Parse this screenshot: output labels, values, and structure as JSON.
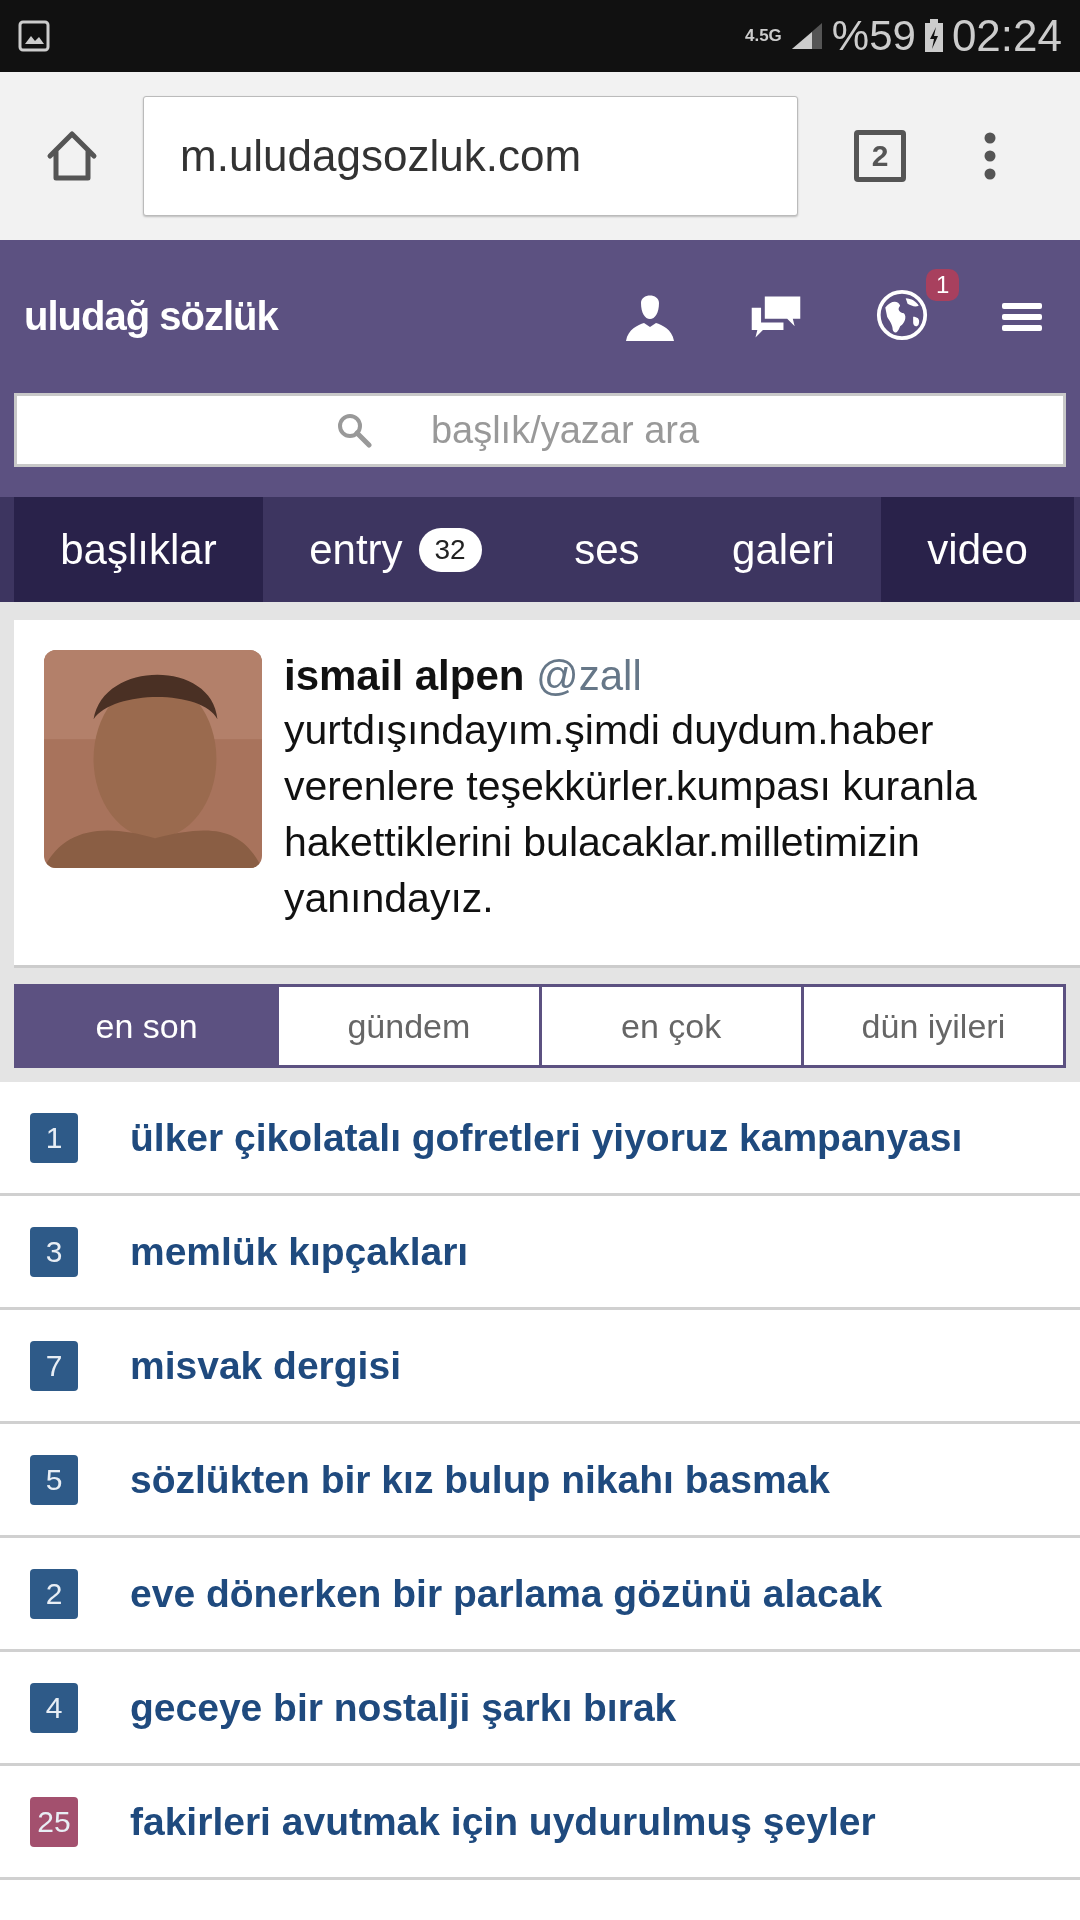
{
  "status_bar": {
    "network": "4.5G",
    "battery": "%59",
    "time": "02:24"
  },
  "browser": {
    "url": "m.uludagsozluk.com",
    "tab_count": "2"
  },
  "site": {
    "logo": "uludağ sözlük",
    "notification_count": "1",
    "search": {
      "placeholder": "başlık/yazar ara"
    }
  },
  "tabs": [
    {
      "label": "başlıklar",
      "selected": true
    },
    {
      "label": "entry",
      "badge": "32",
      "selected": false
    },
    {
      "label": "ses",
      "selected": false
    },
    {
      "label": "galeri",
      "selected": false
    },
    {
      "label": "video",
      "selected": true
    }
  ],
  "tweet": {
    "name": "ismail alpen",
    "handle": "@zall",
    "lines": [
      "yurtdışındayım.şimdi duydum.haber",
      "verenlere teşekkürler.kumpası kuranla",
      "hakettiklerini bulacaklar.milletimizin",
      "yanındayız."
    ]
  },
  "filters": [
    {
      "label": "en son",
      "selected": true
    },
    {
      "label": "gündem",
      "selected": false
    },
    {
      "label": "en çok",
      "selected": false
    },
    {
      "label": "dün iyileri",
      "selected": false
    }
  ],
  "topics": [
    {
      "count": "1",
      "title": "ülker çikolatalı gofretleri yiyoruz kampanyası",
      "color": "#2e5a88"
    },
    {
      "count": "3",
      "title": "memlük kıpçakları",
      "color": "#2e5a88"
    },
    {
      "count": "7",
      "title": "misvak dergisi",
      "color": "#2e5a88"
    },
    {
      "count": "5",
      "title": "sözlükten bir kız bulup nikahı basmak",
      "color": "#2e5a88"
    },
    {
      "count": "2",
      "title": "eve dönerken bir parlama gözünü alacak",
      "color": "#2e5a88"
    },
    {
      "count": "4",
      "title": "geceye bir nostalji şarkı bırak",
      "color": "#2e5a88"
    },
    {
      "count": "25",
      "title": "fakirleri avutmak için uydurulmuş şeyler",
      "color": "#a3506e"
    }
  ]
}
